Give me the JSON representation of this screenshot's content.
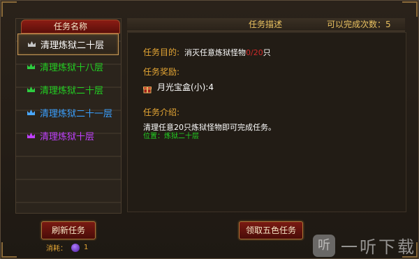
{
  "left": {
    "header": "任务名称",
    "tasks": [
      {
        "name": "清理炼狱二十层",
        "color": "#ffffff",
        "crown_color": "#c8c8c8"
      },
      {
        "name": "清理炼狱十八层",
        "color": "#22d022",
        "crown_color": "#2ecc40"
      },
      {
        "name": "清理炼狱二十层",
        "color": "#22d022",
        "crown_color": "#2ecc40"
      },
      {
        "name": "清理炼狱二十一层",
        "color": "#3aa0ff",
        "crown_color": "#4aa8ff"
      },
      {
        "name": "清理炼狱十层",
        "color": "#c040ff",
        "crown_color": "#c040ff"
      }
    ],
    "refresh_button": "刷新任务",
    "cost_label": "消耗：",
    "cost_value": "1"
  },
  "right": {
    "title": "任务描述",
    "count_text": "可以完成次数：5",
    "goal_label": "任务目的:",
    "goal_text": "消灭任意炼狱怪物",
    "goal_progress": "0/20",
    "goal_unit": "只",
    "reward_label": "任务奖励:",
    "reward_item": "月光宝盒(小):4",
    "intro_label": "任务介绍:",
    "intro_text": "清理任意20只炼狱怪物即可完成任务。",
    "location_text": "位置：炼狱二十层",
    "claim_button": "领取五色任务"
  },
  "watermark": {
    "logo": "听",
    "text": "一听下载"
  }
}
